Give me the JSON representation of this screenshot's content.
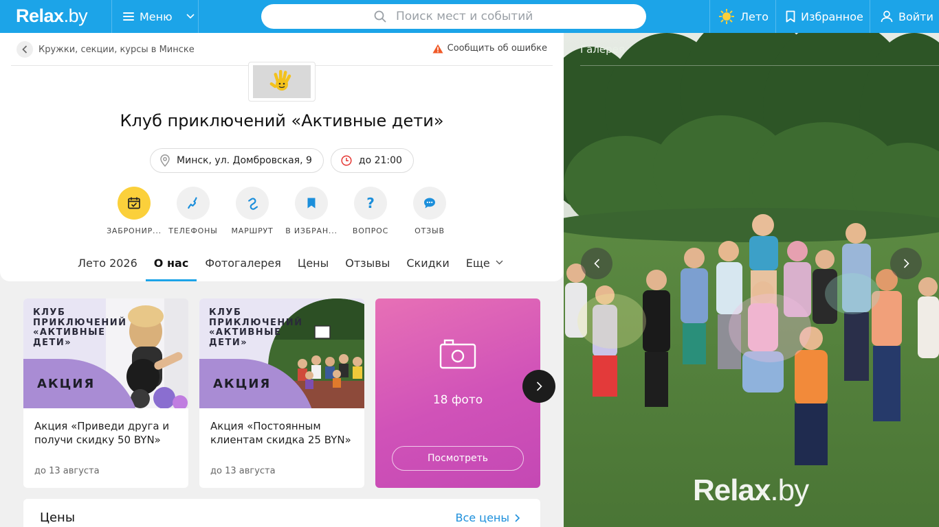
{
  "header": {
    "logo": {
      "main": "Relax",
      "dot": ".by"
    },
    "menu_label": "Меню",
    "search_placeholder": "Поиск мест и событий",
    "season_label": "Лето",
    "favorites_label": "Избранное",
    "login_label": "Войти"
  },
  "breadcrumb": {
    "label": "Кружки, секции, курсы в Минске"
  },
  "report_error": "Сообщить об ошибке",
  "place": {
    "title": "Клуб приключений «Активные дети»",
    "address": "Минск, ул. Домбровская, 9",
    "hours": "до 21:00"
  },
  "actions": [
    {
      "label": "ЗАБРОНИР...",
      "icon": "calendar-check-icon"
    },
    {
      "label": "ТЕЛЕФОНЫ",
      "icon": "phone-icon"
    },
    {
      "label": "МАРШРУТ",
      "icon": "route-icon"
    },
    {
      "label": "В ИЗБРАН...",
      "icon": "bookmark-icon"
    },
    {
      "label": "ВОПРОС",
      "icon": "question-icon"
    },
    {
      "label": "ОТЗЫВ",
      "icon": "chat-icon"
    }
  ],
  "tabs": [
    {
      "label": "Лето 2026",
      "active": false
    },
    {
      "label": "О нас",
      "active": true
    },
    {
      "label": "Фотогалерея",
      "active": false
    },
    {
      "label": "Цены",
      "active": false
    },
    {
      "label": "Отзывы",
      "active": false
    },
    {
      "label": "Скидки",
      "active": false
    },
    {
      "label": "Еще",
      "active": false
    }
  ],
  "promos": [
    {
      "image_heading": "КЛУБ ПРИКЛЮЧЕНИЙ «АКТИВНЫЕ ДЕТИ»",
      "badge": "АКЦИЯ",
      "text": "Акция «Приведи друга и получи скидку 50 BYN»",
      "date": "до 13 августа"
    },
    {
      "image_heading": "КЛУБ ПРИКЛЮЧЕНИЙ «АКТИВНЫЕ ДЕТИ»",
      "badge": "АКЦИЯ",
      "text": "Акция «Постоянным клиентам скидка 25 BYN»",
      "date": "до 13 августа"
    }
  ],
  "photos": {
    "count_label": "18 фото",
    "view_label": "Посмотреть"
  },
  "prices": {
    "title": "Цены",
    "all_label": "Все цены"
  },
  "gallery": {
    "label": "Галерея",
    "watermark": {
      "main": "Relax",
      "dot": ".by"
    }
  },
  "colors": {
    "brand_blue": "#1ca4e8",
    "book_yellow": "#fbd03b",
    "photos_pink": "#d052b8",
    "promo_purple": "#a98cd4",
    "link_blue": "#1c8fdb"
  }
}
